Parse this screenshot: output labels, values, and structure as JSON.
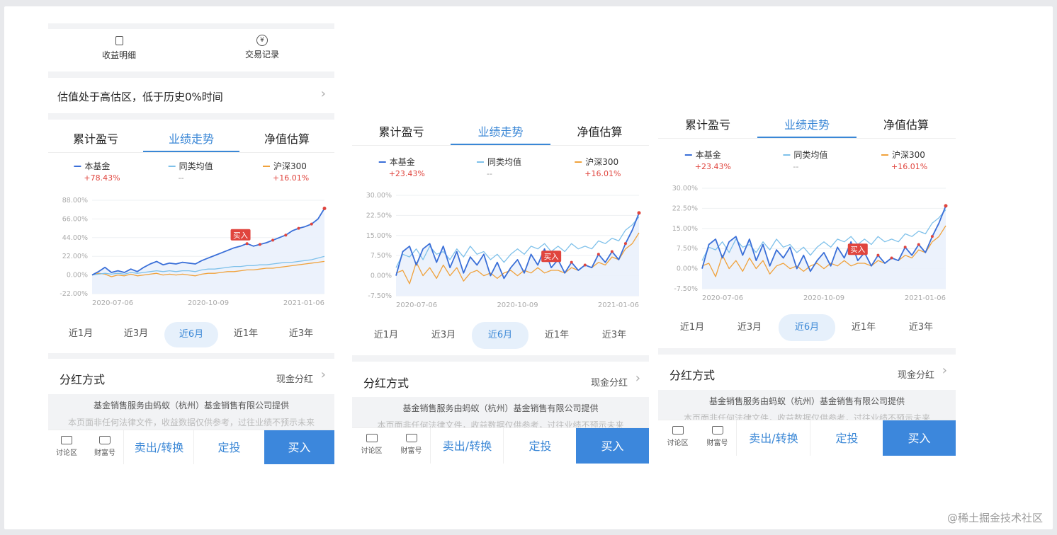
{
  "top_actions": [
    {
      "label": "收益明细",
      "icon": "document-icon"
    },
    {
      "label": "交易记录",
      "icon": "yen-icon"
    }
  ],
  "valuation": {
    "text": "估值处于高估区，低于历史0%时间"
  },
  "tabs": [
    "累计盈亏",
    "业绩走势",
    "净值估算"
  ],
  "active_tab": "业绩走势",
  "legend_names": [
    "本基金",
    "同类均值",
    "沪深300"
  ],
  "periods": [
    "近1月",
    "近3月",
    "近6月",
    "近1年",
    "近3年"
  ],
  "active_period": "近6月",
  "buy_tag": "买入",
  "dividend": {
    "label": "分红方式",
    "value": "现金分红"
  },
  "disclaimer": {
    "line1": "基金销售服务由蚂蚁（杭州）基金销售有限公司提供",
    "line2": "本页面非任何法律文件，收益数据仅供参考，过往业绩不预示未来"
  },
  "bottom_bar": {
    "discuss": "讨论区",
    "wealth": "财富号",
    "sell": "卖出/转换",
    "auto_invest": "定投",
    "buy": "买入"
  },
  "colors": {
    "fund": "#3a6fd8",
    "peer": "#7fc1ea",
    "index": "#f0a23c",
    "accent": "#3a87d6",
    "buy_bg": "#3c87dc",
    "buy_tag": "#e0453e"
  },
  "panels": [
    {
      "id": "p1",
      "legend_values": [
        "+78.43%",
        "--",
        "+16.01%"
      ],
      "chart_data": {
        "type": "line",
        "x_ticks": [
          "2020-07-06",
          "2020-10-09",
          "2021-01-06"
        ],
        "y_ticks": [
          "88.00%",
          "66.00%",
          "44.00%",
          "22.00%",
          "0.00%",
          "-22.00%"
        ],
        "ylim": [
          -22,
          88
        ],
        "series": [
          {
            "name": "本基金",
            "values": [
              0,
              4,
              9,
              3,
              5,
              3,
              7,
              4,
              9,
              13,
              16,
              12,
              14,
              13,
              15,
              14,
              13,
              17,
              20,
              23,
              26,
              29,
              32,
              34,
              37,
              34,
              36,
              38,
              41,
              44,
              47,
              52,
              55,
              57,
              60,
              66,
              78.43
            ]
          },
          {
            "name": "同类均值",
            "values": [
              0,
              1,
              2,
              1,
              2,
              1,
              3,
              2,
              3,
              4,
              5,
              4,
              5,
              4,
              5,
              5,
              4,
              6,
              7,
              7,
              8,
              9,
              10,
              10,
              11,
              11,
              12,
              12,
              13,
              14,
              15,
              15,
              16,
              17,
              18,
              20,
              22
            ]
          },
          {
            "name": "沪深300",
            "values": [
              0,
              2,
              1,
              -2,
              0,
              -1,
              1,
              -1,
              0,
              1,
              2,
              0,
              1,
              0,
              1,
              0,
              -1,
              1,
              2,
              2,
              3,
              4,
              4,
              5,
              6,
              6,
              7,
              8,
              8,
              9,
              10,
              11,
              12,
              13,
              14,
              15,
              16.01
            ]
          }
        ]
      }
    },
    {
      "id": "p2",
      "legend_values": [
        "+23.43%",
        "--",
        "+16.01%"
      ],
      "chart_data": {
        "type": "line",
        "x_ticks": [
          "2020-07-06",
          "2020-10-09",
          "2021-01-06"
        ],
        "y_ticks": [
          "30.00%",
          "22.50%",
          "15.00%",
          "7.50%",
          "0.00%",
          "-7.50%"
        ],
        "ylim": [
          -7.5,
          30
        ],
        "series": [
          {
            "name": "本基金",
            "values": [
              0,
              9,
              11,
              4,
              10,
              12,
              5,
              11,
              3,
              9,
              1,
              7,
              4,
              8,
              0,
              5,
              -1,
              3,
              6,
              1,
              8,
              4,
              10,
              3,
              6,
              1,
              5,
              2,
              4,
              3,
              8,
              5,
              9,
              6,
              12,
              17,
              23.43
            ]
          },
          {
            "name": "同类均值",
            "values": [
              3,
              8,
              7,
              10,
              6,
              11,
              8,
              9,
              6,
              10,
              7,
              11,
              8,
              9,
              6,
              8,
              5,
              8,
              10,
              8,
              11,
              10,
              12,
              9,
              11,
              9,
              12,
              10,
              11,
              10,
              13,
              12,
              14,
              13,
              17,
              19,
              22
            ]
          },
          {
            "name": "沪深300",
            "values": [
              1,
              2,
              -3,
              5,
              0,
              3,
              -1,
              4,
              0,
              3,
              -2,
              1,
              2,
              0,
              1,
              -1,
              1,
              2,
              0,
              2,
              1,
              3,
              1,
              2,
              2,
              1,
              3,
              2,
              4,
              3,
              5,
              4,
              7,
              6,
              10,
              12,
              16.01
            ]
          }
        ]
      }
    },
    {
      "id": "p3",
      "legend_values": [
        "+23.43%",
        "--",
        "+16.01%"
      ],
      "chart_data": {
        "type": "line",
        "x_ticks": [
          "2020-07-06",
          "2020-10-09",
          "2021-01-06"
        ],
        "y_ticks": [
          "30.00%",
          "22.50%",
          "15.00%",
          "7.50%",
          "0.00%",
          "-7.50%"
        ],
        "ylim": [
          -7.5,
          30
        ],
        "series": [
          {
            "name": "本基金",
            "values": [
              0,
              9,
              11,
              4,
              10,
              12,
              5,
              11,
              3,
              9,
              1,
              7,
              4,
              8,
              0,
              5,
              -1,
              3,
              6,
              1,
              8,
              4,
              10,
              3,
              6,
              1,
              5,
              2,
              4,
              3,
              8,
              5,
              9,
              6,
              12,
              17,
              23.43
            ]
          },
          {
            "name": "同类均值",
            "values": [
              3,
              8,
              7,
              10,
              6,
              11,
              8,
              9,
              6,
              10,
              7,
              11,
              8,
              9,
              6,
              8,
              5,
              8,
              10,
              8,
              11,
              10,
              12,
              9,
              11,
              9,
              12,
              10,
              11,
              10,
              13,
              12,
              14,
              13,
              17,
              19,
              22
            ]
          },
          {
            "name": "沪深300",
            "values": [
              1,
              2,
              -3,
              5,
              0,
              3,
              -1,
              4,
              0,
              3,
              -2,
              1,
              2,
              0,
              1,
              -1,
              1,
              2,
              0,
              2,
              1,
              3,
              1,
              2,
              2,
              1,
              3,
              2,
              4,
              3,
              5,
              4,
              7,
              6,
              10,
              12,
              16.01
            ]
          }
        ]
      }
    }
  ],
  "watermark": "@稀土掘金技术社区"
}
